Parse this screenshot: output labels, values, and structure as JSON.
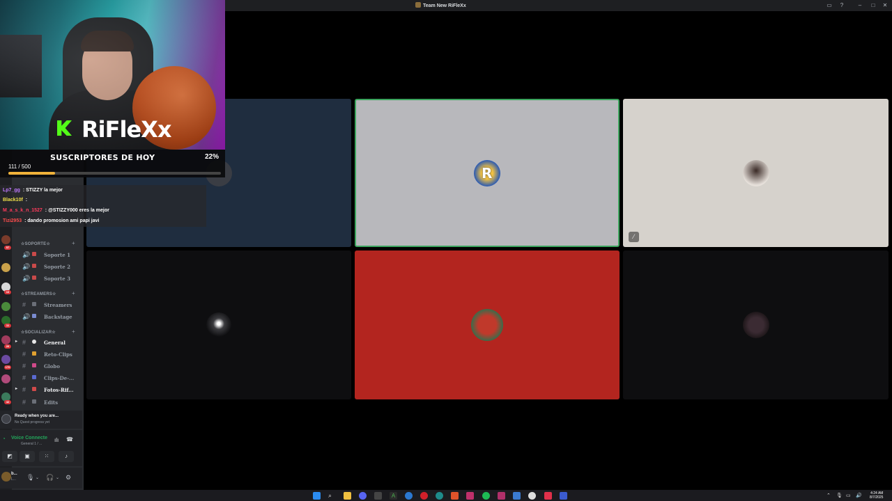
{
  "window": {
    "title": "Team New RiFleXx"
  },
  "webcam": {
    "brand": "RiFleXx"
  },
  "goal": {
    "title": "SUSCRIPTORES DE HOY",
    "percent": "22%",
    "count": "111 / 500",
    "progress": 0.22
  },
  "chat": [
    {
      "user": "Lp7_gg",
      "sep": " : ",
      "msg": "STIZZY la mejor",
      "color": "#c07bff"
    },
    {
      "user": "Black10f",
      "sep": " : ",
      "msg": "",
      "color": "#f0e14a"
    },
    {
      "user": "M_a_s_k_n_1527",
      "sep": " : ",
      "msg": "@STIZZY000 eres la mejor",
      "color": "#ff3b5c"
    },
    {
      "user": "Tizi2953",
      "sep": " : ",
      "msg": "dando promosion ami papi javi",
      "color": "#ff4d4d"
    }
  ],
  "sidebar": {
    "categories": [
      {
        "label": "☆SOPORTE☆"
      },
      {
        "label": "☆STREAMERS☆"
      },
      {
        "label": "☆SOCIALIZAR☆"
      }
    ],
    "channels": [
      {
        "label": "Soporte 1"
      },
      {
        "label": "Soporte 2"
      },
      {
        "label": "Soporte 3"
      },
      {
        "label": "Streamers"
      },
      {
        "label": "Backstage"
      },
      {
        "label": "General"
      },
      {
        "label": "Reto-Clips"
      },
      {
        "label": "Globo"
      },
      {
        "label": "Clips-De-..."
      },
      {
        "label": "Fotos-Rif..."
      },
      {
        "label": "Edits"
      }
    ],
    "server_badges": [
      "57",
      "10",
      "11",
      "26",
      "170",
      "42"
    ]
  },
  "quest": {
    "title": "Ready when you are...",
    "subtitle": "No Quest progress yet"
  },
  "voice": {
    "status": "Voice Connecte",
    "channel": "General 1 / ..."
  },
  "user": {
    "name": "b...",
    "status": "L..."
  },
  "taskbar": {
    "time": "4:24 AM",
    "date": "8/7/2025"
  },
  "colors": {
    "speaking_ring": "#3ba55d",
    "tile_blue": "#1f2d3f",
    "tile_gray": "#b8b8bc",
    "tile_cream": "#d6d2cc",
    "tile_red": "#b3251f",
    "tile_dark": "#0e0e10"
  }
}
